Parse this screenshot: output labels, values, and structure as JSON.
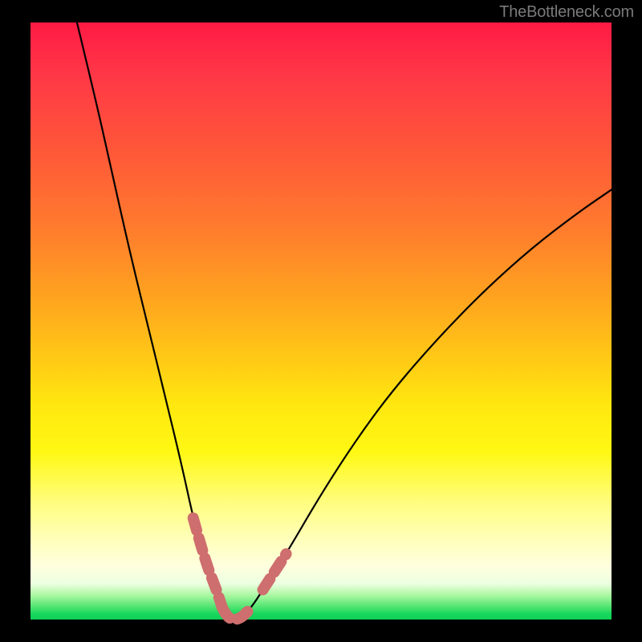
{
  "watermark": "TheBottleneck.com",
  "colors": {
    "curve": "#000000",
    "highlight": "#cf6e6e",
    "background_top": "#ff1a44",
    "background_bottom": "#0ecf54",
    "frame": "#000000"
  },
  "chart_data": {
    "type": "line",
    "title": "",
    "xlabel": "",
    "ylabel": "",
    "xlim": [
      0,
      100
    ],
    "ylim": [
      0,
      100
    ],
    "grid": false,
    "note": "Axes are unlabeled; x/y are normalized 0–100 estimated from pixel position. The curve is a bottleneck-style V reaching ≈0 near x≈34 and rising on both sides.",
    "series": [
      {
        "name": "bottleneck_curve",
        "x": [
          8,
          11,
          14,
          17,
          20,
          23,
          26,
          28,
          30,
          32,
          33,
          34,
          36,
          38,
          40,
          44,
          50,
          56,
          62,
          70,
          78,
          86,
          94,
          100
        ],
        "y": [
          100,
          88,
          75,
          62,
          50,
          38,
          26,
          17,
          10,
          5,
          2,
          0,
          0,
          2,
          5,
          11,
          21,
          30,
          38,
          47,
          55,
          62,
          68,
          72
        ]
      }
    ],
    "highlight_segments": [
      {
        "name": "left_wall_highlight",
        "x": [
          28,
          30,
          32,
          33
        ],
        "y": [
          17,
          10,
          5,
          2
        ]
      },
      {
        "name": "valley_highlight",
        "x": [
          33,
          34,
          36,
          38
        ],
        "y": [
          2,
          0,
          0,
          2
        ]
      },
      {
        "name": "right_wall_highlight",
        "x": [
          40,
          42,
          44
        ],
        "y": [
          5,
          8,
          11
        ]
      }
    ]
  }
}
